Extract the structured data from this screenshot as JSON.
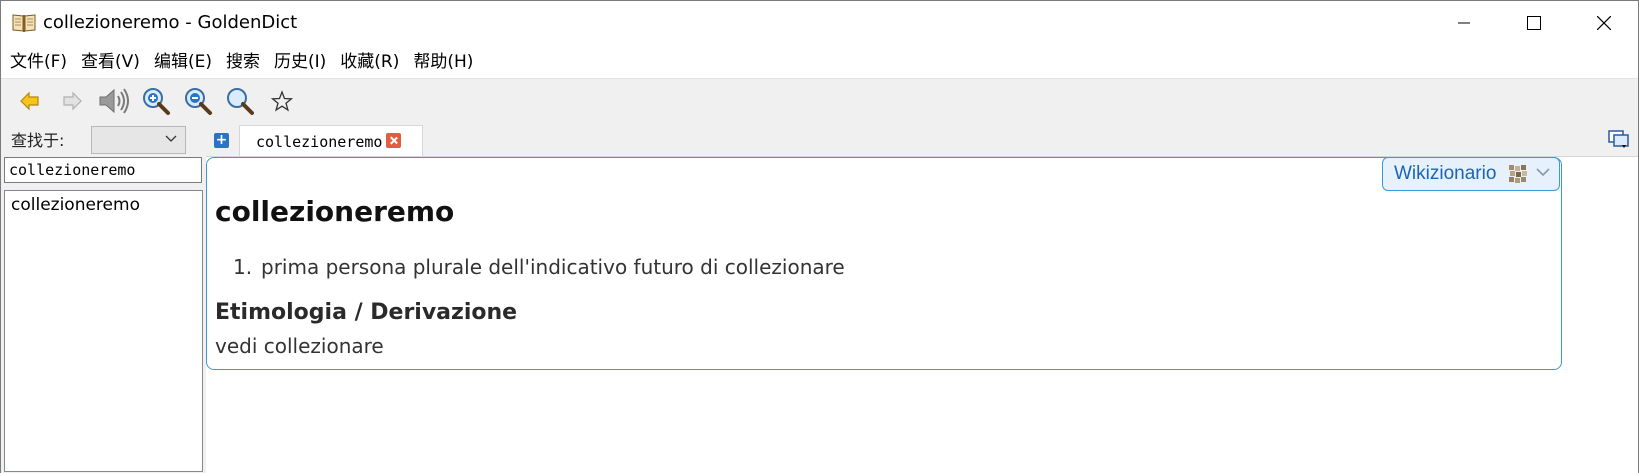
{
  "window": {
    "title": "collezioneremo - GoldenDict",
    "app_icon": "book-icon",
    "controls": [
      "minimize-icon",
      "maximize-icon",
      "close-icon"
    ]
  },
  "menu": {
    "items": [
      {
        "label": "文件(F)"
      },
      {
        "label": "查看(V)"
      },
      {
        "label": "编辑(E)"
      },
      {
        "label": "搜索"
      },
      {
        "label": "历史(I)"
      },
      {
        "label": "收藏(R)"
      },
      {
        "label": "帮助(H)"
      }
    ]
  },
  "toolbar": {
    "icons": [
      "back-arrow-icon",
      "forward-arrow-icon",
      "speaker-icon",
      "zoom-in-icon",
      "zoom-out-icon",
      "zoom-reset-icon",
      "star-icon"
    ]
  },
  "left_pane": {
    "search_in_label": "查找于:",
    "group_selected": "",
    "search_value": "collezioneremo",
    "word_list": [
      "collezioneremo"
    ]
  },
  "tabs": [
    {
      "label": "collezioneremo"
    }
  ],
  "article": {
    "dictionary_name": "Wikizionario",
    "headword": "collezioneremo",
    "definitions": [
      {
        "number": "1.",
        "text": "prima persona plurale dell'indicativo futuro di collezionare"
      }
    ],
    "etymology_heading": "Etimologia / Derivazione",
    "etymology_text": "vedi collezionare"
  },
  "colors": {
    "accent": "#3a9ad9",
    "dict_name": "#1a66b3",
    "toolbar_bg": "#f0f0f0"
  }
}
